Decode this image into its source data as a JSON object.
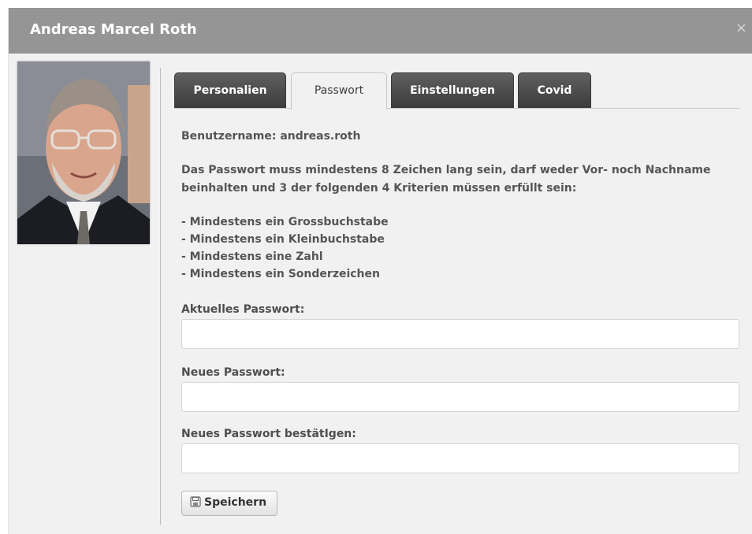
{
  "dialog": {
    "title": "Andreas Marcel Roth",
    "close_glyph": "×"
  },
  "tabs": [
    {
      "label": "Personalien",
      "active": false
    },
    {
      "label": "Passwort",
      "active": true
    },
    {
      "label": "Einstellungen",
      "active": false
    },
    {
      "label": "Covid",
      "active": false
    }
  ],
  "account": {
    "username_label": "Benutzername:",
    "username_value": "andreas.roth"
  },
  "rules": {
    "intro_line1": "Das Passwort muss mindestens 8 Zeichen lang sein, darf weder Vor- noch Nachname",
    "intro_line2": "beinhalten und 3 der folgenden 4 Kriterien müssen erfüllt sein:",
    "items": [
      "- Mindestens ein Grossbuchstabe",
      "- Mindestens ein Kleinbuchstabe",
      "- Mindestens eine Zahl",
      "- Mindestens ein Sonderzeichen"
    ]
  },
  "form": {
    "current_label": "Aktuelles Passwort:",
    "current_value": "",
    "new_label": "Neues Passwort:",
    "new_value": "",
    "confirm_label": "Neues Passwort bestätIgen:",
    "confirm_value": "",
    "save_label": "Speichern",
    "save_icon": "save-icon"
  },
  "colors": {
    "titlebar": "#959595",
    "tab_dark": "#4a4a4a",
    "background": "#f1f1f1"
  }
}
